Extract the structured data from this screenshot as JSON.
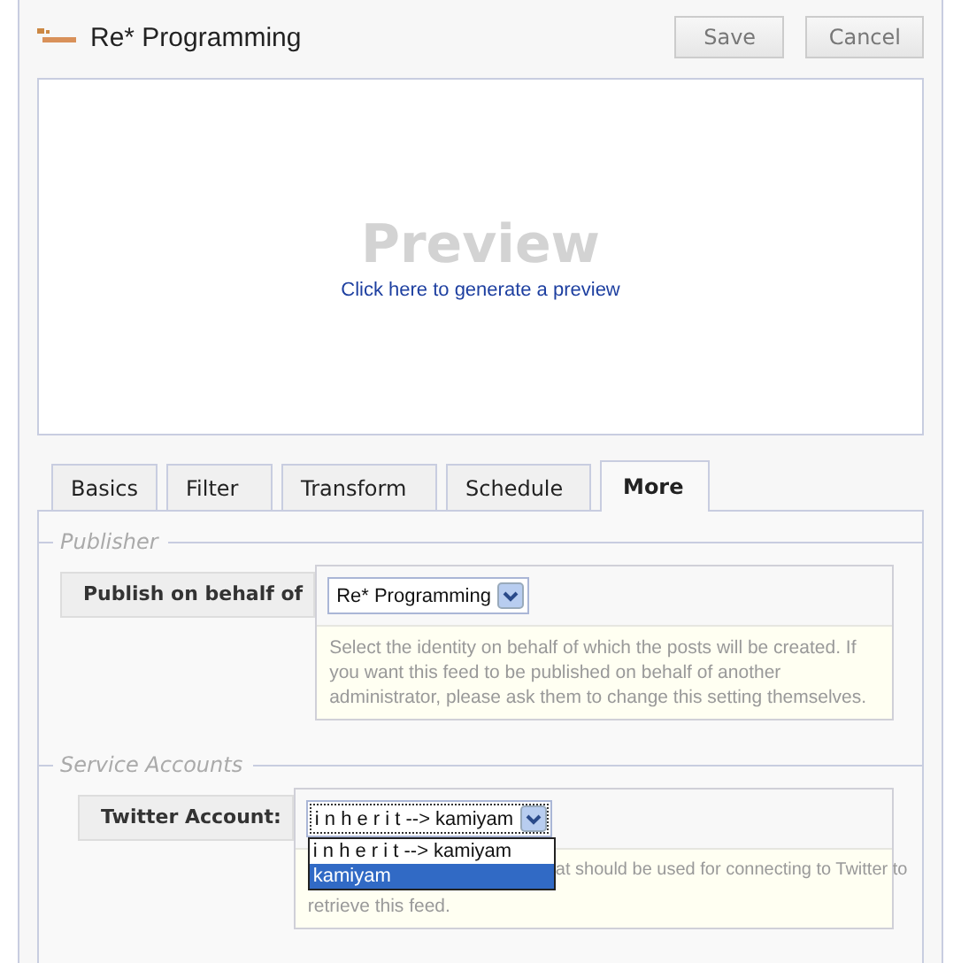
{
  "header": {
    "title": "Re* Programming",
    "buttons": [
      "Save",
      "Cancel"
    ]
  },
  "preview": {
    "heading": "Preview",
    "link": "Click here to generate a preview"
  },
  "tabs": [
    {
      "label": "Basics",
      "selected": false
    },
    {
      "label": "Filter",
      "selected": false
    },
    {
      "label": "Transform",
      "selected": false
    },
    {
      "label": "Schedule",
      "selected": false
    },
    {
      "label": "More",
      "selected": true
    }
  ],
  "sections": [
    {
      "legend": "Publisher",
      "field": {
        "label": "Publish on behalf of",
        "value": "Re* Programming",
        "help": [
          "Select the identity on behalf of which the posts will be created. If you want this feed to be published on behalf of another administrator, please ask them to change this setting themselves."
        ]
      }
    },
    {
      "legend": "Service Accounts",
      "field": {
        "label": "Twitter Account:",
        "value": "i n h e r i t --> kamiyam",
        "help": [
          "at should be used for connecting to Twitter to",
          "retrieve this feed."
        ],
        "options": [
          {
            "label": "i n h e r i t --> kamiyam",
            "highlighted": false
          },
          {
            "label": "kamiyam",
            "highlighted": true
          }
        ]
      }
    }
  ]
}
